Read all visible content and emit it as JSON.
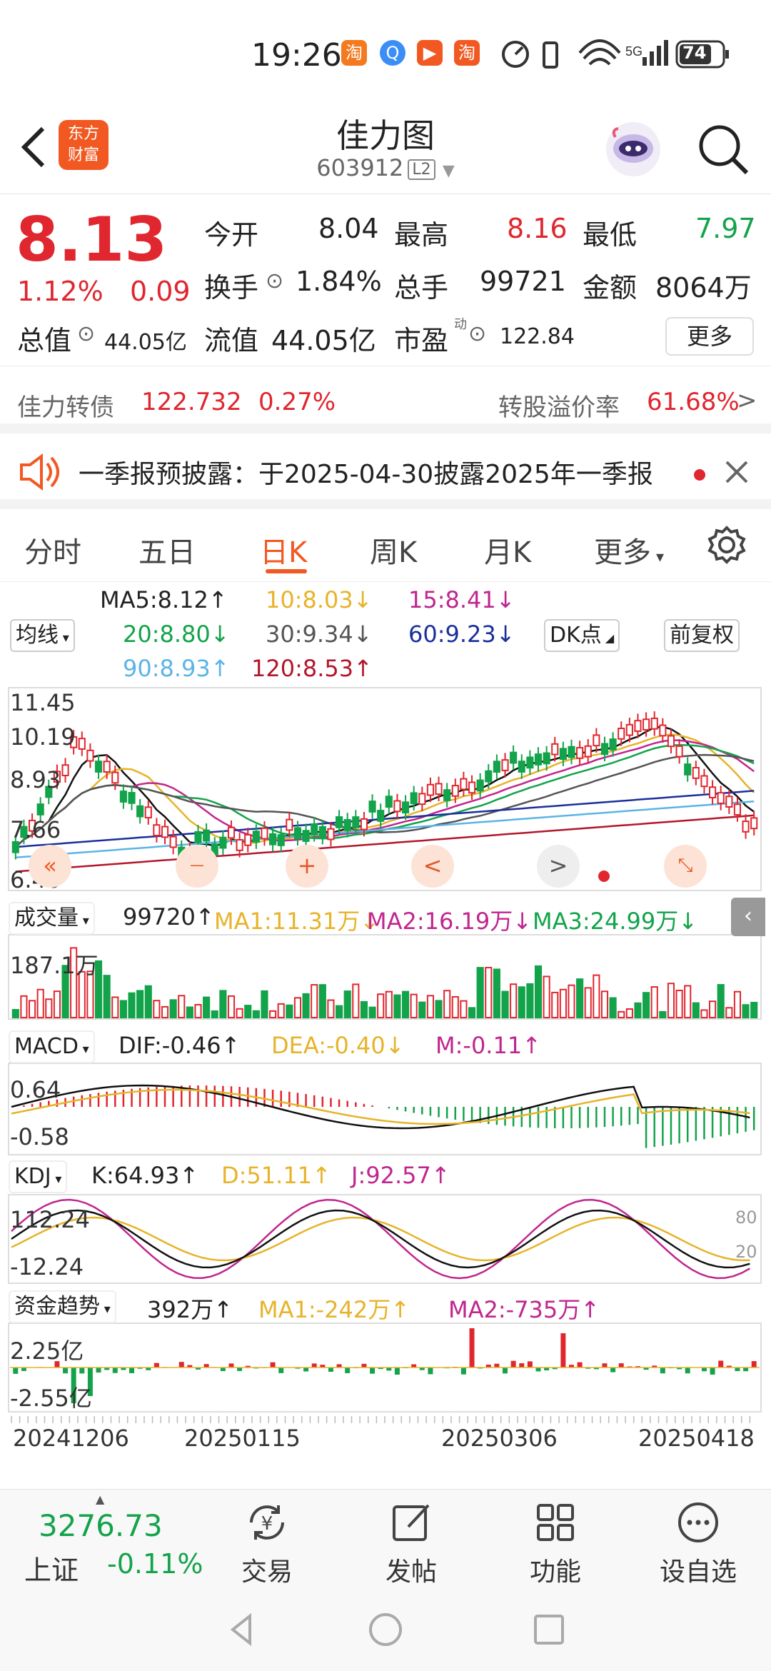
{
  "status_bar": {
    "time": "19:26",
    "network": "5G",
    "battery": "74"
  },
  "header": {
    "title": "佳力图",
    "code": "603912",
    "level": "L2",
    "logo_line1": "东方",
    "logo_line2": "财富"
  },
  "quote": {
    "price": "8.13",
    "change_pct": "1.12%",
    "change": "0.09",
    "open_label": "今开",
    "open": "8.04",
    "high_label": "最高",
    "high": "8.16",
    "low_label": "最低",
    "low": "7.97",
    "turnover_label": "换手",
    "turnover": "1.84%",
    "volume_label": "总手",
    "volume": "99721",
    "amount_label": "金额",
    "amount": "8064万",
    "total_cap_label": "总值",
    "total_cap": "44.05亿",
    "float_cap_label": "流值",
    "float_cap": "44.05亿",
    "pe_label": "市盈",
    "pe_sup": "动",
    "pe": "122.84",
    "more": "更多"
  },
  "convertible": {
    "name": "佳力转债",
    "price": "122.732",
    "pct": "0.27%",
    "premium_label": "转股溢价率",
    "premium": "61.68%"
  },
  "notice": {
    "text": "一季报预披露：于2025-04-30披露2025年一季报"
  },
  "tabs": [
    "分时",
    "五日",
    "日K",
    "周K",
    "月K",
    "更多"
  ],
  "active_tab": "日K",
  "ma": {
    "selector": "均线",
    "ma5": "MA5:8.12↑",
    "ma10": "10:8.03↓",
    "ma15": "15:8.41↓",
    "ma20": "20:8.80↓",
    "ma30": "30:9.34↓",
    "ma60": "60:9.23↓",
    "ma90": "90:8.93↑",
    "ma120": "120:8.53↑",
    "dk": "DK点",
    "adjust": "前复权"
  },
  "kline_axis": [
    "11.45",
    "10.19",
    "8.93",
    "7.66",
    "6.40"
  ],
  "volume": {
    "selector": "成交量",
    "value": "99720↑",
    "ma1": "MA1:11.31万↓",
    "ma2": "MA2:16.19万↓",
    "ma3": "MA3:24.99万↓",
    "axis_top": "187.1万"
  },
  "macd": {
    "selector": "MACD",
    "dif": "DIF:-0.46↑",
    "dea": "DEA:-0.40↓",
    "m": "M:-0.11↑",
    "axis_top": "0.64",
    "axis_bottom": "-0.58"
  },
  "kdj": {
    "selector": "KDJ",
    "k": "K:64.93↑",
    "d": "D:51.11↑",
    "j": "J:92.57↑",
    "axis_top": "112.24",
    "axis_bottom": "-12.24",
    "right_top": "80",
    "right_bottom": "20"
  },
  "fund": {
    "selector": "资金趋势",
    "value": "392万↑",
    "ma1": "MA1:-242万↑",
    "ma2": "MA2:-735万↑",
    "axis_top": "2.25亿",
    "axis_bottom": "-2.55亿"
  },
  "dates": [
    "20241206",
    "20250115",
    "20250306",
    "20250418"
  ],
  "bottom": {
    "index_value": "3276.73",
    "index_name": "上证",
    "index_pct": "-0.11%",
    "trade": "交易",
    "post": "发帖",
    "function": "功能",
    "watchlist": "设自选"
  },
  "colors": {
    "up": "#e0262e",
    "down": "#13a34a",
    "accent": "#f25922"
  }
}
